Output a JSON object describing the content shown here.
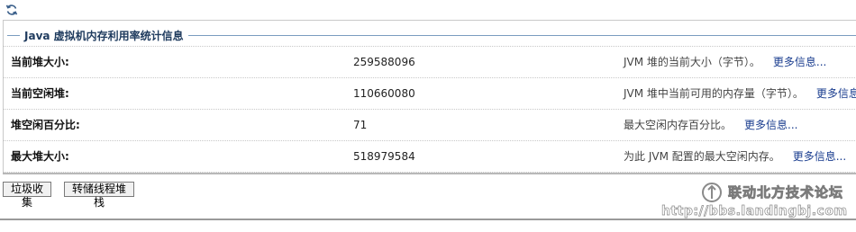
{
  "toolbar": {
    "refresh_icon": "refresh-icon"
  },
  "section": {
    "title": "Java 虚拟机内存利用率统计信息"
  },
  "rows": [
    {
      "label": "当前堆大小:",
      "value": "259588096",
      "description": "JVM 堆的当前大小（字节）。",
      "more": "更多信息..."
    },
    {
      "label": "当前空闲堆:",
      "value": "110660080",
      "description": "JVM 堆中当前可用的内存量（字节）。",
      "more": "更多信息..."
    },
    {
      "label": "堆空闲百分比:",
      "value": "71",
      "description": "最大空闲内存百分比。",
      "more": "更多信息..."
    },
    {
      "label": "最大堆大小:",
      "value": "518979584",
      "description": "为此 JVM 配置的最大空闲内存。",
      "more": "更多信息..."
    }
  ],
  "buttons": {
    "gc": "垃圾收集",
    "dump": "转储线程堆栈"
  },
  "watermark": {
    "name": "联动北方技术论坛",
    "url": "http://bbs.landingbj.com"
  }
}
